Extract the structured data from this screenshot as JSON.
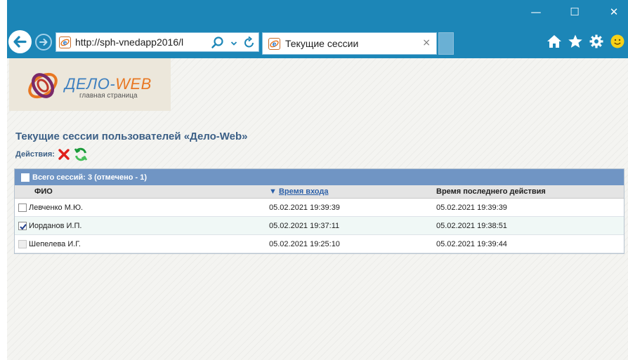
{
  "browser": {
    "url": "http://sph-vnedapp2016/l",
    "tab_title": "Текущие сессии",
    "tab_close": "×",
    "window_controls": [
      "—",
      "☐",
      "✕"
    ]
  },
  "logo": {
    "brand_main": "ДЕЛО-",
    "brand_accent": "WEB",
    "subtitle": "главная страница"
  },
  "page": {
    "title": "Текущие сессии пользователей «Дело-Web»",
    "actions_label": "Действия:"
  },
  "table": {
    "summary": "Всего сессий: 3 (отмечено - 1)",
    "columns": {
      "name": "ФИО",
      "login_time": "Время входа",
      "last_action": "Время последнего действия"
    },
    "sort_indicator": "▼",
    "rows": [
      {
        "name": "Левченко М.Ю.",
        "login_time": "05.02.2021 19:39:39",
        "last_action": "05.02.2021 19:39:39",
        "checked": false
      },
      {
        "name": "Иорданов И.П.",
        "login_time": "05.02.2021 19:37:11",
        "last_action": "05.02.2021 19:38:51",
        "checked": true
      },
      {
        "name": "Шепелева И.Г.",
        "login_time": "05.02.2021 19:25:10",
        "last_action": "05.02.2021 19:39:44",
        "checked": false
      }
    ]
  },
  "colors": {
    "chrome": "#1c86b7",
    "table_header": "#7095c4",
    "heading": "#3b5f86"
  },
  "icons": [
    "back-arrow-icon",
    "forward-arrow-icon",
    "ie-page-icon",
    "search-icon",
    "dropdown-icon",
    "refresh-icon",
    "home-icon",
    "favorites-star-icon",
    "settings-gear-icon",
    "smiley-feedback-icon",
    "delete-x-icon",
    "refresh-sessions-icon"
  ]
}
